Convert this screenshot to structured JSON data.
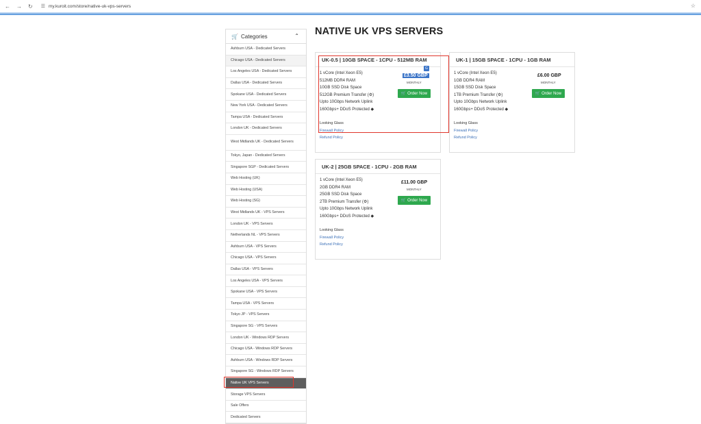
{
  "browser": {
    "url": "my.kuroit.com/store/native-uk-vps-servers"
  },
  "sidebar": {
    "heading": "Categories",
    "items": [
      {
        "label": "Ashburn USA - Dedicated Servers"
      },
      {
        "label": "Chicago USA - Dedicated Servers"
      },
      {
        "label": "Los Angeles USA - Dedicated Servers"
      },
      {
        "label": "Dallas USA - Dedicated Servers"
      },
      {
        "label": "Spokane USA - Dedicated Servers"
      },
      {
        "label": "New York USA - Dedicated Servers"
      },
      {
        "label": "Tampa USA - Dedicated Servers"
      },
      {
        "label": "London UK - Dedicated Servers"
      },
      {
        "label": "West Midlands UK - Dedicated Servers"
      },
      {
        "label": "Tokyo, Japan - Dedicated Servers"
      },
      {
        "label": "Singapore SGP - Dedicated Servers"
      },
      {
        "label": "Web Hosting (UK)"
      },
      {
        "label": "Web Hosting (USA)"
      },
      {
        "label": "Web Hosting (SG)"
      },
      {
        "label": "West Midlands UK - VPS Servers"
      },
      {
        "label": "London UK - VPS Servers"
      },
      {
        "label": "Netherlands NL - VPS Servers"
      },
      {
        "label": "Ashburn USA - VPS Servers"
      },
      {
        "label": "Chicago USA - VPS Servers"
      },
      {
        "label": "Dallas USA - VPS Servers"
      },
      {
        "label": "Los Angeles USA - VPS Servers"
      },
      {
        "label": "Spokane USA - VPS Servers"
      },
      {
        "label": "Tampa USA - VPS Servers"
      },
      {
        "label": "Tokyo JP - VPS Servers"
      },
      {
        "label": "Singapore SG - VPS Servers"
      },
      {
        "label": "London UK - Windows RDP Servers"
      },
      {
        "label": "Chicago USA - Windows RDP Servers"
      },
      {
        "label": "Ashburn USA - Windows RDP Servers"
      },
      {
        "label": "Singapore SG - Windows RDP Servers"
      },
      {
        "label": "Native UK VPS Servers"
      },
      {
        "label": "Storage VPS Servers"
      },
      {
        "label": "Sale Offers"
      },
      {
        "label": "Dedicated Servers"
      }
    ]
  },
  "main": {
    "title": "NATIVE UK VPS SERVERS",
    "products": [
      {
        "name": "UK-0.5 | 10GB SPACE - 1CPU - 512MB RAM",
        "features": [
          "1 vCore (Intel Xeon E5)",
          "512MB DDR4 RAM",
          "10GB SSD Disk Space",
          "512GB Premium Transfer (⚙)",
          "Upto 10Gbps Network Uplink",
          "160Gbps+ DDoS Protected ◆"
        ],
        "price": "£3.50 GBP",
        "cycle": "MONTHLY",
        "order": "Order Now",
        "links": [
          "Looking Glass",
          "Firewall Policy",
          "Refund Policy"
        ]
      },
      {
        "name": "UK-1 | 15GB SPACE - 1CPU - 1GB RAM",
        "features": [
          "1 vCore (Intel Xeon E5)",
          "1GB DDR4 RAM",
          "15GB SSD Disk Space",
          "1TB Premium Transfer (⚙)",
          "Upto 10Gbps Network Uplink",
          "160Gbps+ DDoS Protected ◆"
        ],
        "price": "£6.00 GBP",
        "cycle": "MONTHLY",
        "order": "Order Now",
        "links": [
          "Looking Glass",
          "Firewall Policy",
          "Refund Policy"
        ]
      },
      {
        "name": "UK-2 | 25GB SPACE - 1CPU - 2GB RAM",
        "features": [
          "1 vCore (Intel Xeon E5)",
          "2GB DDR4 RAM",
          "25GB SSD Disk Space",
          "2TB Premium Transfer (⚙)",
          "Upto 10Gbps Network Uplink",
          "160Gbps+ DDoS Protected ◆"
        ],
        "price": "£11.00 GBP",
        "cycle": "MONTHLY",
        "order": "Order Now",
        "links": [
          "Looking Glass",
          "Firewall Policy",
          "Refund Policy"
        ]
      }
    ]
  },
  "colors": {
    "accent": "#3b74c7",
    "order_button": "#2ea84e",
    "highlight": "#e0352b",
    "active_category": "#5e5e5e"
  }
}
